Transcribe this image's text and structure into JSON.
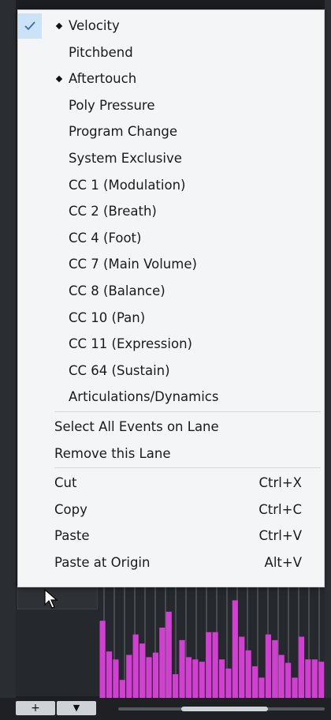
{
  "menu": {
    "controller_items": [
      {
        "label": "Velocity",
        "checked": true,
        "diamond": true
      },
      {
        "label": "Pitchbend",
        "checked": false,
        "diamond": false
      },
      {
        "label": "Aftertouch",
        "checked": false,
        "diamond": true
      },
      {
        "label": "Poly Pressure",
        "checked": false,
        "diamond": false
      },
      {
        "label": "Program Change",
        "checked": false,
        "diamond": false
      },
      {
        "label": "System Exclusive",
        "checked": false,
        "diamond": false
      },
      {
        "label": "CC 1  (Modulation)",
        "checked": false,
        "diamond": false
      },
      {
        "label": "CC 2  (Breath)",
        "checked": false,
        "diamond": false
      },
      {
        "label": "CC 4  (Foot)",
        "checked": false,
        "diamond": false
      },
      {
        "label": "CC 7  (Main Volume)",
        "checked": false,
        "diamond": false
      },
      {
        "label": "CC 8  (Balance)",
        "checked": false,
        "diamond": false
      },
      {
        "label": "CC 10  (Pan)",
        "checked": false,
        "diamond": false
      },
      {
        "label": "CC 11  (Expression)",
        "checked": false,
        "diamond": false
      },
      {
        "label": "CC 64  (Sustain)",
        "checked": false,
        "diamond": false
      },
      {
        "label": "Articulations/Dynamics",
        "checked": false,
        "diamond": false
      }
    ],
    "lane_items": [
      {
        "label": "Select All Events on Lane"
      },
      {
        "label": "Remove this Lane"
      }
    ],
    "edit_items": [
      {
        "label": "Cut",
        "shortcut": "Ctrl+X"
      },
      {
        "label": "Copy",
        "shortcut": "Ctrl+C"
      },
      {
        "label": "Paste",
        "shortcut": "Ctrl+V"
      },
      {
        "label": "Paste at Origin",
        "shortcut": "Alt+V"
      }
    ]
  },
  "lane_controls": {
    "add_label": "+",
    "dropdown_label": "▼"
  },
  "velocity_lane": {
    "values": [
      0.72,
      0.45,
      0.38,
      0.2,
      0.42,
      0.6,
      0.52,
      0.4,
      0.44,
      0.66,
      0.8,
      0.25,
      0.55,
      0.4,
      0.38,
      0.36,
      0.62,
      0.62,
      0.38,
      0.3,
      0.9,
      0.58,
      0.46,
      0.32,
      0.22,
      0.6,
      0.55,
      0.42,
      0.35,
      0.22,
      0.58,
      0.38,
      0.38,
      0.36
    ],
    "bar_color": "#d23fd2",
    "grid_color": "#9a9ea3"
  },
  "colors": {
    "menu_bg": "#f4f5f7",
    "check_highlight": "#cbe2f7",
    "check_color": "#2f6fb0"
  }
}
